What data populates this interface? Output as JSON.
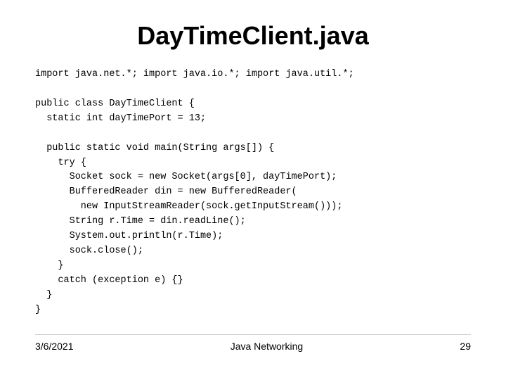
{
  "slide": {
    "title": "DayTimeClient.java",
    "code": "import java.net.*; import java.io.*; import java.util.*;\n\npublic class DayTimeClient {\n  static int dayTimePort = 13;\n\n  public static void main(String args[]) {\n    try {\n      Socket sock = new Socket(args[0], dayTimePort);\n      BufferedReader din = new BufferedReader(\n        new InputStreamReader(sock.getInputStream()));\n      String r.Time = din.readLine();\n      System.out.println(r.Time);\n      sock.close();\n    }\n    catch (exception e) {}\n  }\n}",
    "footer": {
      "date": "3/6/2021",
      "topic": "Java Networking",
      "page": "29"
    }
  }
}
